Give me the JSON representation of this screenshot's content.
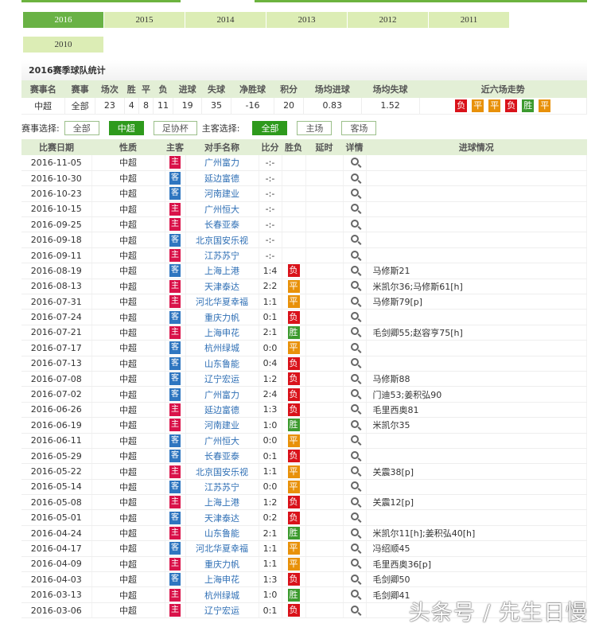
{
  "year_tabs": [
    "2016",
    "2015",
    "2014",
    "2013",
    "2012",
    "2011",
    "2010"
  ],
  "stats": {
    "title": "2016赛季球队统计",
    "headers": [
      "赛事名",
      "赛事",
      "场次",
      "胜",
      "平",
      "负",
      "进球",
      "失球",
      "净胜球",
      "积分",
      "场均进球",
      "场均失球",
      "近六场走势"
    ],
    "values": [
      "中超",
      "全部",
      "23",
      "4",
      "8",
      "11",
      "19",
      "35",
      "-16",
      "20",
      "0.83",
      "1.52"
    ],
    "recent": [
      "负",
      "平",
      "平",
      "负",
      "胜",
      "平"
    ]
  },
  "filter": {
    "comp_label": "赛事选择:",
    "comp_options": [
      "全部",
      "中超",
      "足协杯"
    ],
    "ha_label": "主客选择:",
    "ha_options": [
      "全部",
      "主场",
      "客场"
    ]
  },
  "table_headers": [
    "比赛日期",
    "性质",
    "主客",
    "对手名称",
    "比分",
    "胜负",
    "延时",
    "详情",
    "进球情况"
  ],
  "matches": [
    [
      "2016-11-05",
      "中超",
      "主",
      "广州富力",
      "-:-",
      "",
      ""
    ],
    [
      "2016-10-30",
      "中超",
      "客",
      "延边富德",
      "-:-",
      "",
      ""
    ],
    [
      "2016-10-23",
      "中超",
      "客",
      "河南建业",
      "-:-",
      "",
      ""
    ],
    [
      "2016-10-15",
      "中超",
      "主",
      "广州恒大",
      "-:-",
      "",
      ""
    ],
    [
      "2016-09-25",
      "中超",
      "主",
      "长春亚泰",
      "-:-",
      "",
      ""
    ],
    [
      "2016-09-18",
      "中超",
      "客",
      "北京国安乐视",
      "-:-",
      "",
      ""
    ],
    [
      "2016-09-11",
      "中超",
      "主",
      "江苏苏宁",
      "-:-",
      "",
      ""
    ],
    [
      "2016-08-19",
      "中超",
      "客",
      "上海上港",
      "1:4",
      "负",
      "马修斯21"
    ],
    [
      "2016-08-13",
      "中超",
      "主",
      "天津泰达",
      "2:2",
      "平",
      "米凯尔36;马修斯61[h]"
    ],
    [
      "2016-07-31",
      "中超",
      "主",
      "河北华夏幸福",
      "1:1",
      "平",
      "马修斯79[p]"
    ],
    [
      "2016-07-24",
      "中超",
      "客",
      "重庆力帆",
      "0:1",
      "负",
      ""
    ],
    [
      "2016-07-21",
      "中超",
      "主",
      "上海申花",
      "2:1",
      "胜",
      "毛剑卿55;赵容亨75[h]"
    ],
    [
      "2016-07-17",
      "中超",
      "客",
      "杭州绿城",
      "0:0",
      "平",
      ""
    ],
    [
      "2016-07-13",
      "中超",
      "客",
      "山东鲁能",
      "0:4",
      "负",
      ""
    ],
    [
      "2016-07-08",
      "中超",
      "客",
      "辽宁宏运",
      "1:2",
      "负",
      "马修斯88"
    ],
    [
      "2016-07-02",
      "中超",
      "客",
      "广州富力",
      "2:4",
      "负",
      "门迪53;姜积弘90"
    ],
    [
      "2016-06-26",
      "中超",
      "主",
      "延边富德",
      "1:3",
      "负",
      "毛里西奥81"
    ],
    [
      "2016-06-19",
      "中超",
      "主",
      "河南建业",
      "1:0",
      "胜",
      "米凯尔35"
    ],
    [
      "2016-06-11",
      "中超",
      "客",
      "广州恒大",
      "0:0",
      "平",
      ""
    ],
    [
      "2016-05-29",
      "中超",
      "客",
      "长春亚泰",
      "0:1",
      "负",
      ""
    ],
    [
      "2016-05-22",
      "中超",
      "主",
      "北京国安乐视",
      "1:1",
      "平",
      "关震38[p]"
    ],
    [
      "2016-05-14",
      "中超",
      "客",
      "江苏苏宁",
      "0:0",
      "平",
      ""
    ],
    [
      "2016-05-08",
      "中超",
      "主",
      "上海上港",
      "1:2",
      "负",
      "关震12[p]"
    ],
    [
      "2016-05-01",
      "中超",
      "客",
      "天津泰达",
      "0:2",
      "负",
      ""
    ],
    [
      "2016-04-24",
      "中超",
      "主",
      "山东鲁能",
      "2:1",
      "胜",
      "米凯尔11[h];姜积弘40[h]"
    ],
    [
      "2016-04-17",
      "中超",
      "客",
      "河北华夏幸福",
      "1:1",
      "平",
      "冯绍顺45"
    ],
    [
      "2016-04-09",
      "中超",
      "主",
      "重庆力帆",
      "1:1",
      "平",
      "毛里西奥36[p]"
    ],
    [
      "2016-04-03",
      "中超",
      "客",
      "上海申花",
      "1:3",
      "负",
      "毛剑卿50"
    ],
    [
      "2016-03-13",
      "中超",
      "主",
      "杭州绿城",
      "1:0",
      "胜",
      "毛剑卿41"
    ],
    [
      "2016-03-06",
      "中超",
      "主",
      "辽宁宏运",
      "0:1",
      "负",
      ""
    ]
  ],
  "watermark": "头条号 / 先生日慢",
  "colors": {
    "win": "#3c9a2e",
    "draw": "#e8910a",
    "lose": "#d9121a",
    "home": "#d9134a",
    "away": "#2f76c0",
    "accent": "#69b245"
  }
}
